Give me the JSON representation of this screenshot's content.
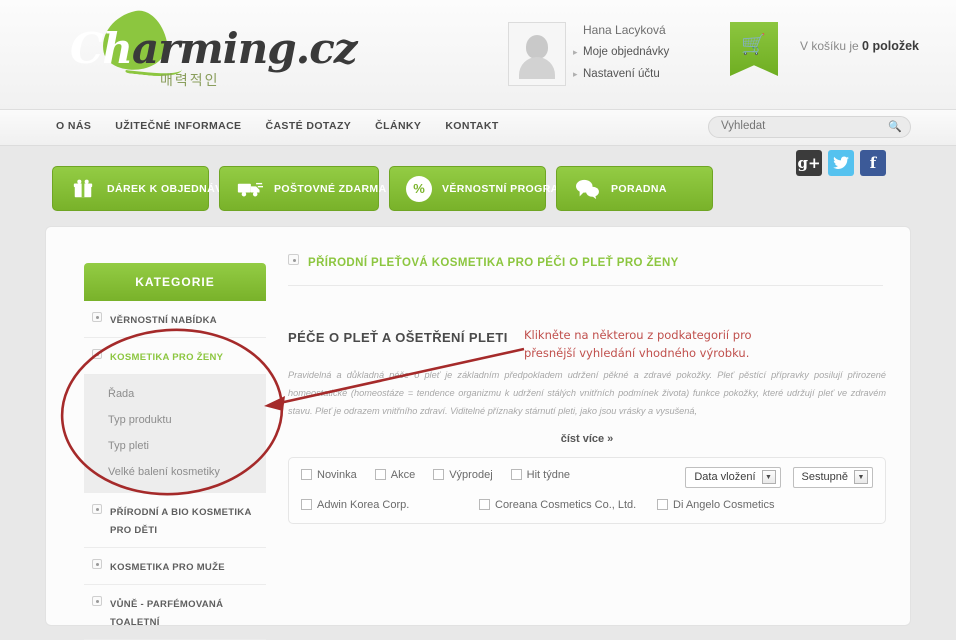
{
  "header": {
    "logo": {
      "ch": "Ch",
      "rest": "arming",
      "dot": ".",
      "tld": "cz",
      "sub": "매력적인"
    },
    "account": {
      "name": "Hana Lacyková",
      "orders_label": "Moje objednávky",
      "settings_label": "Nastavení účtu",
      "avatar_name": "avatar"
    },
    "cart": {
      "prefix": "V košíku je",
      "count_label": "0 položek",
      "icon": "cart-icon"
    }
  },
  "nav": {
    "items": [
      {
        "label": "O NÁS"
      },
      {
        "label": "UŽITEČNÉ INFORMACE"
      },
      {
        "label": "ČASTÉ DOTAZY"
      },
      {
        "label": "ČLÁNKY"
      },
      {
        "label": "KONTAKT"
      }
    ],
    "search": {
      "placeholder": "Vyhledat",
      "value": "",
      "icon": "search-icon"
    }
  },
  "promos": [
    {
      "label": "DÁREK K OBJEDNÁVCE",
      "icon": "gift-icon",
      "glyph": "Ἰ1"
    },
    {
      "label": "POŠTOVNÉ ZDARMA",
      "icon": "truck-icon",
      "glyph": ""
    },
    {
      "label": "VĚRNOSTNÍ PROGRAM",
      "icon": "percent-icon",
      "glyph": "%"
    },
    {
      "label": "PORADNA",
      "icon": "chat-bubbles-icon",
      "glyph": ""
    }
  ],
  "social": [
    {
      "name": "google-plus-icon",
      "glyph": "g+",
      "color": "#3b3b3b"
    },
    {
      "name": "twitter-icon",
      "glyph": "t",
      "color": "#55c2ef"
    },
    {
      "name": "facebook-icon",
      "glyph": "f",
      "color": "#3c5a98"
    }
  ],
  "sidebar": {
    "title": "KATEGORIE",
    "items": [
      {
        "label": "VĚRNOSTNÍ NABÍDKA",
        "active": false
      },
      {
        "label": "KOSMETIKA PRO ŽENY",
        "active": true
      },
      {
        "label": "PŘÍRODNÍ A BIO KOSMETIKA PRO DĚTI",
        "active": false
      },
      {
        "label": "KOSMETIKA PRO MUŽE",
        "active": false
      },
      {
        "label": "VŮNĚ - PARFÉMOVANÁ TOALETNÍ",
        "active": false
      }
    ],
    "subitems": [
      {
        "label": "Řada"
      },
      {
        "label": "Typ produktu"
      },
      {
        "label": "Typ pleti"
      },
      {
        "label": "Velké balení kosmetiky"
      }
    ]
  },
  "main": {
    "breadcrumb": "PŘÍRODNÍ PLEŤOVÁ KOSMETIKA PRO PÉČI O PLEŤ PRO ŽENY",
    "section_title": "PÉČE O PLEŤ A OŠETŘENÍ PLETI",
    "body_text": "Pravidelná a důkladná péče o pleť je základním předpokladem udržení pěkné a zdravé pokožky. Pleť pěstící přípravky posilují přirozené homeostatické (homeostáze = tendence organizmu k udržení stálých vnitřních podmínek života) funkce pokožky, které udržují pleť ve zdravém stavu. Pleť je odrazem vnitřního zdraví. Viditelné příznaky stárnutí pleti, jako jsou vrásky a vysušená,",
    "read_more": "číst více »",
    "filters": {
      "tags": [
        {
          "label": "Novinka",
          "checked": false
        },
        {
          "label": "Akce",
          "checked": false
        },
        {
          "label": "Výprodej",
          "checked": false
        },
        {
          "label": "Hit týdne",
          "checked": false
        }
      ],
      "sort_field": {
        "value": "Data vložení"
      },
      "sort_order": {
        "value": "Sestupně"
      },
      "brands": [
        {
          "label": "Adwin Korea Corp.",
          "checked": false
        },
        {
          "label": "Coreana Cosmetics Co., Ltd.",
          "checked": false
        },
        {
          "label": "Di Angelo Cosmetics",
          "checked": false
        }
      ]
    }
  },
  "annotation": {
    "line1": "Klikněte na některou z podkategorií pro",
    "line2": "přesnější vyhledání vhodného  výrobku.",
    "color": "#c0504d"
  },
  "colors": {
    "brand_green": "#8cc63f",
    "green_dark": "#79b22a",
    "annotation_red": "#c0504d",
    "page_bg": "#e8e8e8"
  }
}
